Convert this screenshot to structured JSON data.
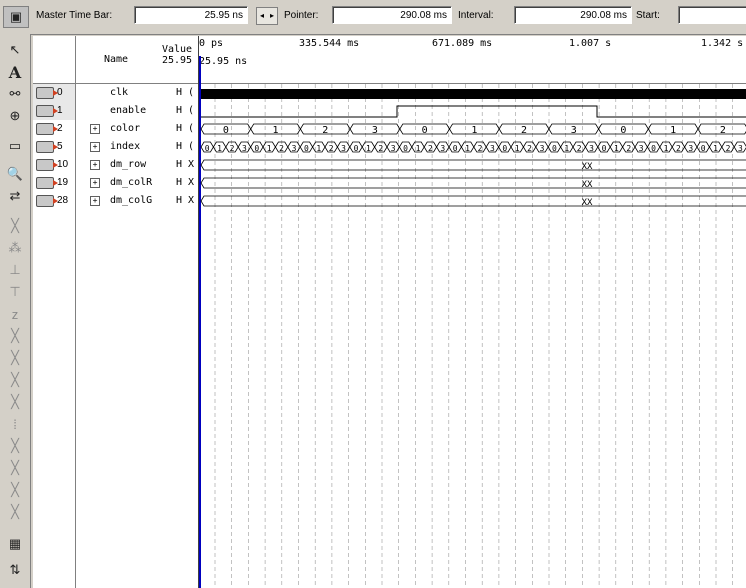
{
  "topbar": {
    "master_label": "Master Time Bar:",
    "master_value": "25.95 ns",
    "pointer_label": "Pointer:",
    "pointer_value": "290.08 ms",
    "interval_label": "Interval:",
    "interval_value": "290.08 ms",
    "start_label": "Start:",
    "start_value": ""
  },
  "columns": {
    "name": "Name",
    "value_line1": "Value",
    "value_line2": "25.95"
  },
  "timeline": {
    "cursor_label": "25.95 ns",
    "ticks": [
      "0 ps",
      "335.544 ms",
      "671.089 ms",
      "1.007 s",
      "1.342 s"
    ]
  },
  "signals": [
    {
      "id": "0",
      "name": "clk",
      "value": "H (",
      "expandable": false
    },
    {
      "id": "1",
      "name": "enable",
      "value": "H (",
      "expandable": false
    },
    {
      "id": "2",
      "name": "color",
      "value": "H (",
      "expandable": true
    },
    {
      "id": "5",
      "name": "index",
      "value": "H (",
      "expandable": true
    },
    {
      "id": "10",
      "name": "dm_row",
      "value": "H X",
      "expandable": true
    },
    {
      "id": "19",
      "name": "dm_colR",
      "value": "H X",
      "expandable": true
    },
    {
      "id": "28",
      "name": "dm_colG",
      "value": "H X",
      "expandable": true
    }
  ],
  "waves": {
    "color_values": [
      "0",
      "1",
      "2",
      "3",
      "0",
      "1",
      "2",
      "3",
      "0",
      "1",
      "2"
    ],
    "index_values": [
      "0",
      "1",
      "2",
      "3"
    ],
    "xx_label": "XX"
  }
}
